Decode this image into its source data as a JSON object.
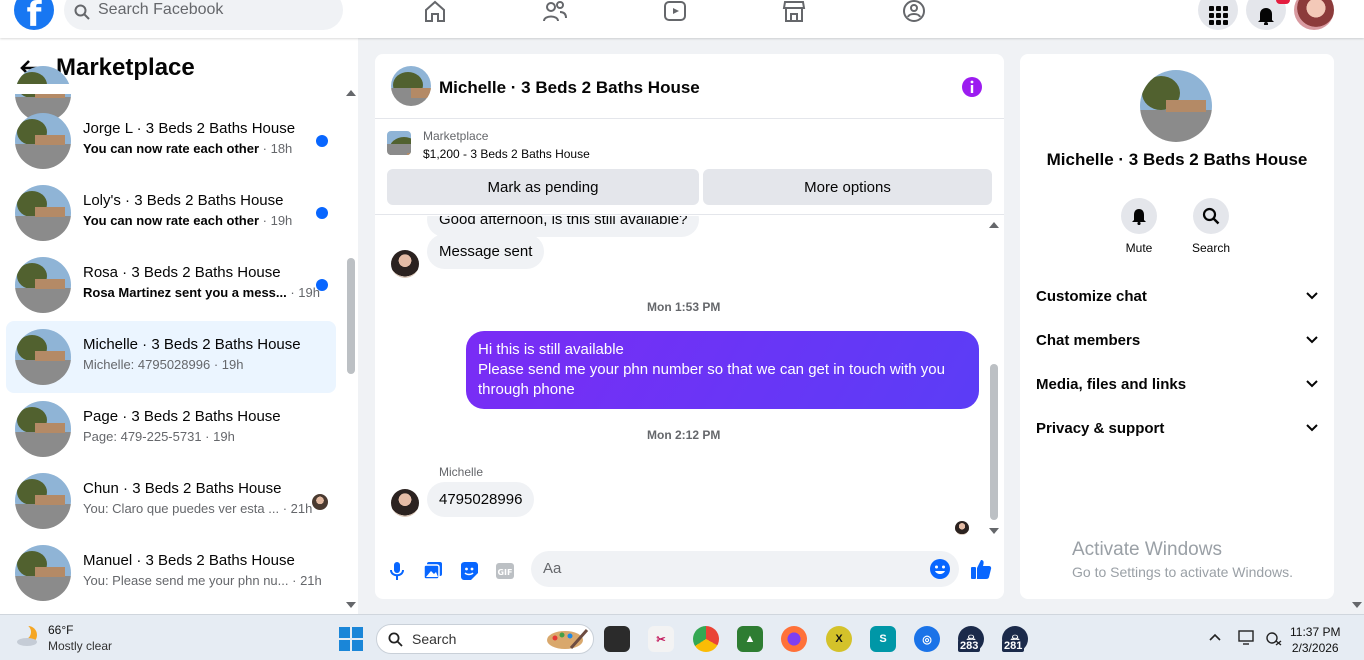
{
  "topnav": {
    "search_placeholder": "Search Facebook",
    "nav_icons": [
      "home-icon",
      "friends-icon",
      "watch-icon",
      "marketplace-icon",
      "groups-icon"
    ],
    "right_icons": [
      "menu-grid-icon",
      "notifications-icon",
      "account-avatar"
    ],
    "accent": "#1877f2"
  },
  "left": {
    "title": "Marketplace",
    "conversations": [
      {
        "name": "Jorge L · 3 Beds 2 Baths House",
        "preview": "You can now rate each other",
        "time": "· 18h",
        "unread": true
      },
      {
        "name": "Loly's · 3 Beds 2 Baths House",
        "preview": "You can now rate each other",
        "time": "· 19h",
        "unread": true
      },
      {
        "name": "Rosa · 3 Beds 2 Baths House",
        "preview": "Rosa Martinez sent you a mess...",
        "time": "· 19h",
        "unread": true
      },
      {
        "name": "Michelle · 3 Beds 2 Baths House",
        "preview": "Michelle: 4795028996",
        "time": "· 19h",
        "unread": false,
        "active": true
      },
      {
        "name": "Page · 3 Beds 2 Baths House",
        "preview": "Page: 479-225-5731",
        "time": "· 19h",
        "unread": false
      },
      {
        "name": "Chun · 3 Beds 2 Baths House",
        "preview": "You: Claro que puedes ver esta ...",
        "time": "· 21h",
        "unread": false,
        "seen": true
      },
      {
        "name": "Manuel · 3 Beds 2 Baths House",
        "preview": "You: Please send me your phn nu...",
        "time": "· 21h",
        "unread": false
      }
    ]
  },
  "chat": {
    "title": "Michelle · 3 Beds 2 Baths House",
    "listing_label": "Marketplace",
    "listing_price": "$1,200 - 3 Beds 2 Baths House",
    "btn_pending": "Mark as pending",
    "btn_more": "More options",
    "msg_partial": "Good afternoon, is this still available?",
    "msg_sent_notice": "Message sent",
    "ts1": "Mon 1:53 PM",
    "out_line1": "Hi this is still available",
    "out_line2": "Please send me your phn number so that we can get in touch with you through phone",
    "ts2": "Mon 2:12 PM",
    "sender": "Michelle",
    "msg_phone": "4795028996",
    "composer_placeholder": "Aa",
    "accent": "#0866ff"
  },
  "right": {
    "title": "Michelle · 3 Beds 2 Baths House",
    "mute": "Mute",
    "search": "Search",
    "sections": [
      "Customize chat",
      "Chat members",
      "Media, files and links",
      "Privacy & support"
    ],
    "activate_1": "Activate Windows",
    "activate_2": "Go to Settings to activate Windows."
  },
  "taskbar": {
    "temp": "66°F",
    "condition": "Mostly clear",
    "search_placeholder": "Search",
    "badge_1": "283",
    "badge_2": "281",
    "time": "11:37 PM",
    "date": "2/3/2026"
  }
}
